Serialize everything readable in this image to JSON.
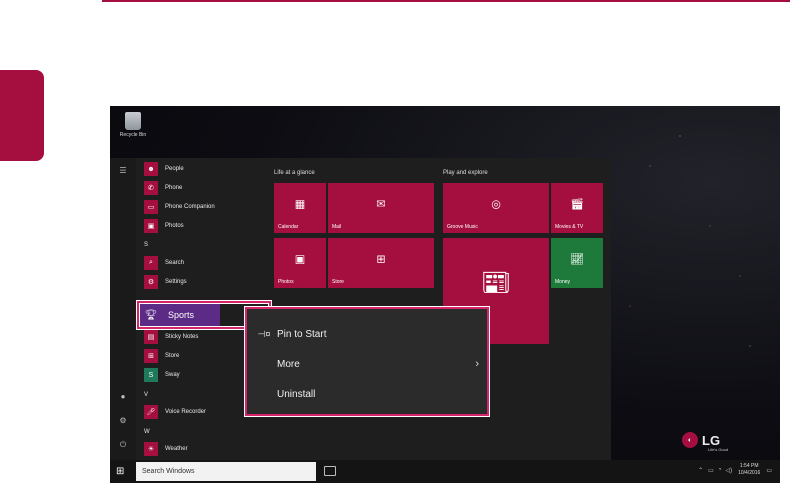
{
  "desktop": {
    "recycle_bin_label": "Recycle Bin",
    "brand": {
      "logo_text": "LG",
      "tagline": "Life's Good"
    }
  },
  "start_menu": {
    "apps": [
      {
        "label": "People",
        "icon": "people-icon"
      },
      {
        "label": "Phone",
        "icon": "phone-icon"
      },
      {
        "label": "Phone Companion",
        "icon": "phone-companion-icon"
      },
      {
        "label": "Photos",
        "icon": "photos-icon"
      },
      {
        "letter": "S"
      },
      {
        "label": "Search",
        "icon": "search-icon"
      },
      {
        "label": "Settings",
        "icon": "gear-icon"
      },
      {
        "label": "Sports",
        "icon": "trophy-icon",
        "selected": true
      },
      {
        "label": "Sticky Notes",
        "icon": "sticky-notes-icon"
      },
      {
        "label": "Store",
        "icon": "store-icon"
      },
      {
        "label": "Sway",
        "icon": "sway-icon"
      },
      {
        "letter": "V"
      },
      {
        "label": "Voice Recorder",
        "icon": "microphone-icon"
      },
      {
        "letter": "W"
      },
      {
        "label": "Weather",
        "icon": "weather-icon"
      }
    ],
    "groups": [
      {
        "title": "Life at a glance",
        "tiles": [
          {
            "label": "Calendar",
            "icon": "calendar-icon"
          },
          {
            "label": "Mail",
            "icon": "mail-icon"
          },
          {
            "label": "Photos",
            "icon": "photos-icon"
          },
          {
            "label": "Store",
            "icon": "store-icon"
          }
        ]
      },
      {
        "title": "Play and explore",
        "tiles": [
          {
            "label": "Groove Music",
            "icon": "music-icon"
          },
          {
            "label": "Movies & TV",
            "icon": "movies-icon"
          },
          {
            "label": "",
            "icon": "news-icon"
          },
          {
            "label": "Money",
            "icon": "chart-icon"
          }
        ]
      }
    ]
  },
  "context_menu": {
    "items": [
      {
        "label": "Pin to Start",
        "icon": "pin-icon"
      },
      {
        "label": "More",
        "has_submenu": true
      },
      {
        "label": "Uninstall"
      }
    ]
  },
  "taskbar": {
    "search_placeholder": "Search Windows",
    "time": "1:54 PM",
    "date": "10/4/2016"
  },
  "colors": {
    "accent": "#a50f40",
    "selection": "#5b2b86",
    "highlight_frame": "#d4246a",
    "money_tile": "#1e7a3a"
  }
}
